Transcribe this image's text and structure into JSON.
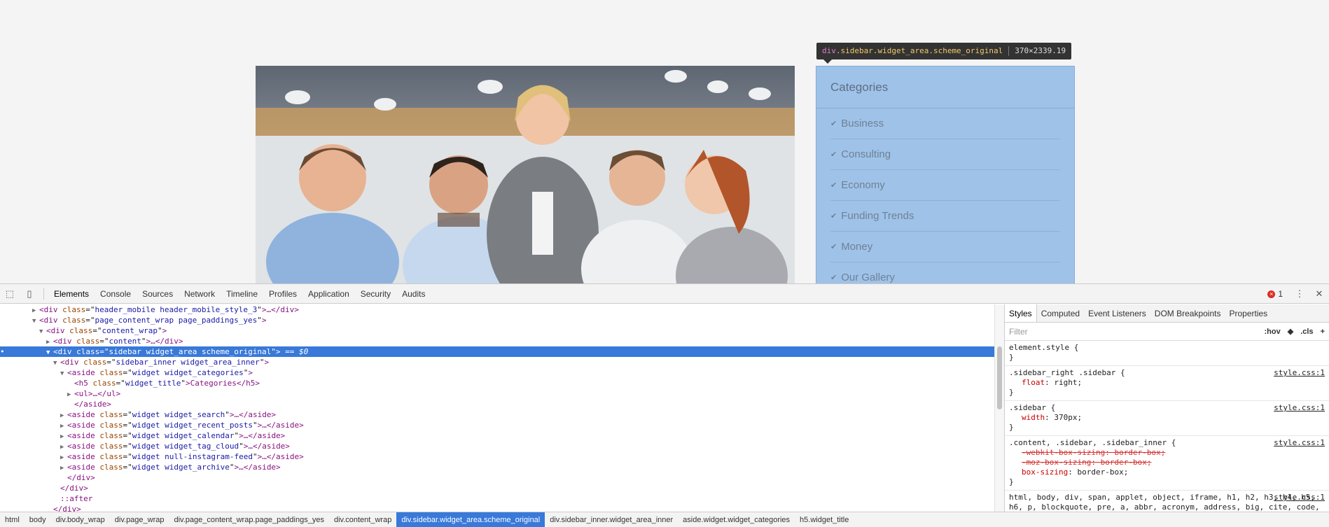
{
  "tooltip": {
    "tag": "div",
    "classes": ".sidebar.widget_area.scheme_original",
    "size": "370×2339.19"
  },
  "sidebar": {
    "title": "Categories",
    "items": [
      {
        "label": "Business"
      },
      {
        "label": "Consulting"
      },
      {
        "label": "Economy"
      },
      {
        "label": "Funding Trends"
      },
      {
        "label": "Money"
      },
      {
        "label": "Our Gallery"
      }
    ]
  },
  "devtools": {
    "tabs": [
      "Elements",
      "Console",
      "Sources",
      "Network",
      "Timeline",
      "Profiles",
      "Application",
      "Security",
      "Audits"
    ],
    "error_count": "1",
    "dom": [
      {
        "indent": 4,
        "arrow": "▶",
        "tag": "div",
        "attrs": [
          {
            "name": "class",
            "value": "header_mobile header_mobile_style_3"
          }
        ],
        "tail": "…</div>"
      },
      {
        "indent": 4,
        "arrow": "▼",
        "tag": "div",
        "attrs": [
          {
            "name": "class",
            "value": "page_content_wrap page_paddings_yes"
          }
        ],
        "tail": ""
      },
      {
        "indent": 5,
        "arrow": "▼",
        "tag": "div",
        "attrs": [
          {
            "name": "class",
            "value": "content_wrap"
          }
        ],
        "tail": ""
      },
      {
        "indent": 6,
        "arrow": "▶",
        "tag": "div",
        "attrs": [
          {
            "name": "class",
            "value": "content"
          }
        ],
        "tail": "…</div>"
      },
      {
        "indent": 6,
        "arrow": "▼",
        "tag": "div",
        "attrs": [
          {
            "name": "class",
            "value": "sidebar widget_area scheme_original"
          }
        ],
        "tail": "",
        "selected": true,
        "dollar": " == $0"
      },
      {
        "indent": 7,
        "arrow": "▼",
        "tag": "div",
        "attrs": [
          {
            "name": "class",
            "value": "sidebar_inner widget_area_inner"
          }
        ],
        "tail": ""
      },
      {
        "indent": 8,
        "arrow": "▼",
        "tag": "aside",
        "attrs": [
          {
            "name": "class",
            "value": "widget widget_categories"
          }
        ],
        "tail": ""
      },
      {
        "indent": 9,
        "arrow": "",
        "tag": "h5",
        "attrs": [
          {
            "name": "class",
            "value": "widget_title"
          }
        ],
        "tail": "Categories</h5>"
      },
      {
        "indent": 9,
        "arrow": "▶",
        "tag": "ul",
        "attrs": [],
        "tail": "…</ul>"
      },
      {
        "indent": 9,
        "arrow": "",
        "raw": "</aside>"
      },
      {
        "indent": 8,
        "arrow": "▶",
        "tag": "aside",
        "attrs": [
          {
            "name": "class",
            "value": "widget widget_search"
          }
        ],
        "tail": "…</aside>"
      },
      {
        "indent": 8,
        "arrow": "▶",
        "tag": "aside",
        "attrs": [
          {
            "name": "class",
            "value": "widget widget_recent_posts"
          }
        ],
        "tail": "…</aside>"
      },
      {
        "indent": 8,
        "arrow": "▶",
        "tag": "aside",
        "attrs": [
          {
            "name": "class",
            "value": "widget widget_calendar"
          }
        ],
        "tail": "…</aside>"
      },
      {
        "indent": 8,
        "arrow": "▶",
        "tag": "aside",
        "attrs": [
          {
            "name": "class",
            "value": "widget widget_tag_cloud"
          }
        ],
        "tail": "…</aside>"
      },
      {
        "indent": 8,
        "arrow": "▶",
        "tag": "aside",
        "attrs": [
          {
            "name": "class",
            "value": "widget null-instagram-feed"
          }
        ],
        "tail": "…</aside>"
      },
      {
        "indent": 8,
        "arrow": "▶",
        "tag": "aside",
        "attrs": [
          {
            "name": "class",
            "value": "widget widget_archive"
          }
        ],
        "tail": "…</aside>"
      },
      {
        "indent": 8,
        "arrow": "",
        "raw": "</div>"
      },
      {
        "indent": 7,
        "arrow": "",
        "raw": "</div>"
      },
      {
        "indent": 7,
        "arrow": "",
        "raw": "::after"
      },
      {
        "indent": 6,
        "arrow": "",
        "raw": "</div>"
      }
    ],
    "styles": {
      "tabs": [
        "Styles",
        "Computed",
        "Event Listeners",
        "DOM Breakpoints",
        "Properties"
      ],
      "filter_placeholder": "Filter",
      "hov": ":hov",
      "cls": ".cls",
      "rules": [
        {
          "selector": "element.style {",
          "source": "",
          "props": [],
          "close": "}"
        },
        {
          "selector": ".sidebar_right .sidebar {",
          "source": "style.css:1",
          "props": [
            {
              "name": "float",
              "value": "right;",
              "struck": false
            }
          ],
          "close": "}"
        },
        {
          "selector": ".sidebar {",
          "source": "style.css:1",
          "props": [
            {
              "name": "width",
              "value": "370px;",
              "struck": false
            }
          ],
          "close": "}"
        },
        {
          "selector": ".content, .sidebar, .sidebar_inner {",
          "source": "style.css:1",
          "props": [
            {
              "name": "-webkit-box-sizing",
              "value": "border-box;",
              "struck": true
            },
            {
              "name": "-moz-box-sizing",
              "value": "border-box;",
              "struck": true
            },
            {
              "name": "box-sizing",
              "value": "border-box;",
              "struck": false
            }
          ],
          "close": "}"
        },
        {
          "selector": "html, body, div, span, applet, object, iframe, h1, h2, h3, h4, h5, h6, p, blockquote, pre, a, abbr, acronym, address, big, cite, code, del, dfn, em, font, ins, kbd, q, s, samp, small, strike, strong, sub, sup, tt, var, dl, dt, dd, ol, ul, li, fieldset, form,",
          "source": "style.css:1",
          "props": [],
          "close": ""
        }
      ]
    },
    "breadcrumbs": [
      {
        "label": "html",
        "active": false
      },
      {
        "label": "body",
        "active": false
      },
      {
        "label": "div.body_wrap",
        "active": false
      },
      {
        "label": "div.page_wrap",
        "active": false
      },
      {
        "label": "div.page_content_wrap.page_paddings_yes",
        "active": false
      },
      {
        "label": "div.content_wrap",
        "active": false
      },
      {
        "label": "div.sidebar.widget_area.scheme_original",
        "active": true
      },
      {
        "label": "div.sidebar_inner.widget_area_inner",
        "active": false
      },
      {
        "label": "aside.widget.widget_categories",
        "active": false
      },
      {
        "label": "h5.widget_title",
        "active": false
      }
    ]
  }
}
